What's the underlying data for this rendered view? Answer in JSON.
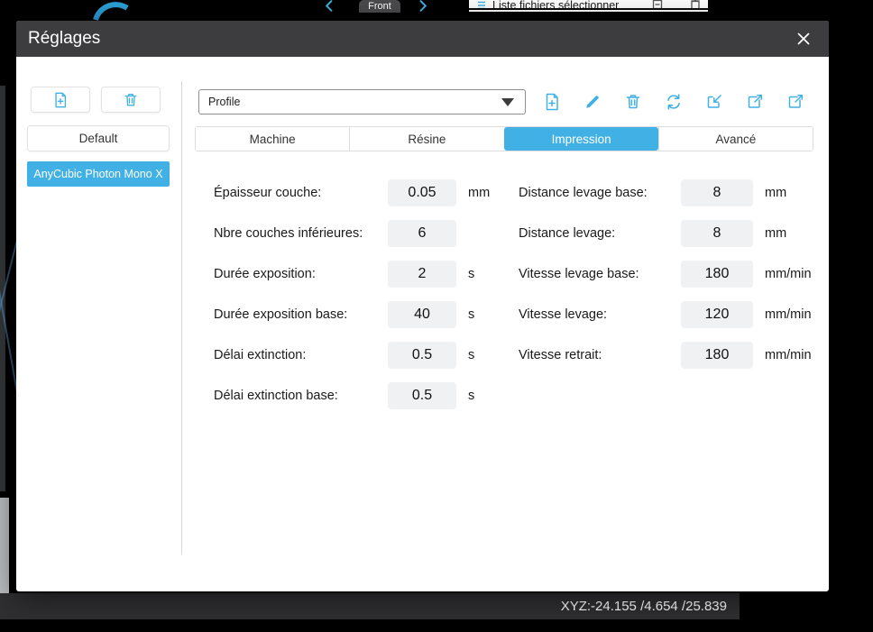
{
  "colors": {
    "accent": "#41b1e5",
    "titlebar": "#3d3d40",
    "field_background": "#eff1f3",
    "status_bar": "#2f2f31"
  },
  "background": {
    "front_tab_label": "Front",
    "file_list_header": "Liste fichiers sélectionner",
    "status_xyz": "XYZ:-24.155 /4.654 /25.839"
  },
  "dialog": {
    "title": "Réglages",
    "left_panel": {
      "default_button_label": "Default",
      "selected_printer": "AnyCubic Photon Mono X"
    },
    "profile_dropdown_value": "Profile",
    "tabs": [
      {
        "label": "Machine"
      },
      {
        "label": "Résine"
      },
      {
        "label": "Impression",
        "active": true
      },
      {
        "label": "Avancé"
      }
    ],
    "form": {
      "left": [
        {
          "label": "Épaisseur couche:",
          "value": "0.05",
          "unit": "mm"
        },
        {
          "label": "Nbre couches inférieures:",
          "value": "6",
          "unit": ""
        },
        {
          "label": "Durée exposition:",
          "value": "2",
          "unit": "s"
        },
        {
          "label": "Durée exposition base:",
          "value": "40",
          "unit": "s"
        },
        {
          "label": "Délai extinction:",
          "value": "0.5",
          "unit": "s"
        },
        {
          "label": "Délai extinction base:",
          "value": "0.5",
          "unit": "s"
        }
      ],
      "right": [
        {
          "label": "Distance levage base:",
          "value": "8",
          "unit": "mm"
        },
        {
          "label": "Distance levage:",
          "value": "8",
          "unit": "mm"
        },
        {
          "label": "Vitesse levage base:",
          "value": "180",
          "unit": "mm/min"
        },
        {
          "label": "Vitesse levage:",
          "value": "120",
          "unit": "mm/min"
        },
        {
          "label": "Vitesse retrait:",
          "value": "180",
          "unit": "mm/min"
        }
      ]
    }
  },
  "icons": {
    "close": "x-cross",
    "add_profile": "page-plus",
    "edit": "pencil",
    "delete": "trash",
    "refresh": "sync-arrows",
    "import": "box-arrow-in",
    "export": "box-arrow-out",
    "share": "box-arrow-out",
    "dropdown_caret": "triangle-down",
    "view_prev": "chevron-left",
    "view_next": "chevron-right",
    "file_list": "list-lines"
  }
}
